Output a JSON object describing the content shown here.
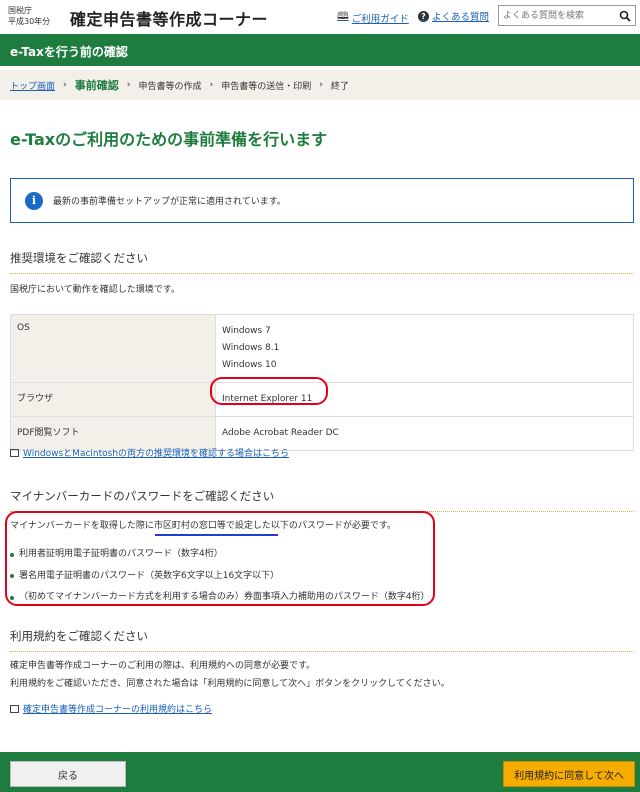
{
  "header": {
    "agency_line1": "国税庁",
    "agency_line2": "平成30年分",
    "site_title": "確定申告書等作成コーナー",
    "guide_link": "ご利用ガイド",
    "faq_link": "よくある質問",
    "search_placeholder": "よくある質問を検索"
  },
  "banner": {
    "title": "e-Taxを行う前の確認"
  },
  "breadcrumb": {
    "items": [
      "トップ画面",
      "事前確認",
      "申告書等の作成",
      "申告書等の送信・印刷",
      "終了"
    ]
  },
  "page_title": "e-Taxのご利用のための事前準備を行います",
  "info_message": "最新の事前準備セットアップが正常に適用されています。",
  "env_section": {
    "heading": "推奨環境をご確認ください",
    "desc": "国税庁において動作を確認した環境です。",
    "rows": [
      {
        "key": "OS",
        "values": [
          "Windows 7",
          "Windows 8.1",
          "Windows 10"
        ]
      },
      {
        "key": "ブラウザ",
        "values": [
          "Internet Explorer 11"
        ]
      },
      {
        "key": "PDF閲覧ソフト",
        "values": [
          "Adobe Acrobat Reader DC"
        ]
      }
    ],
    "link": "WindowsとMacintoshの両方の推奨環境を確認する場合はこちら"
  },
  "password_section": {
    "heading": "マイナンバーカードのパスワードをご確認ください",
    "intro_before": "マイナンバーカードを取得した際に",
    "intro_highlight": "市区町村の窓口等で設定した",
    "intro_after": "以下のパスワードが必要です。",
    "items": [
      "利用者証明用電子証明書のパスワード（数字4桁）",
      "署名用電子証明書のパスワード（英数字6文字以上16文字以下）",
      "（初めてマイナンバーカード方式を利用する場合のみ）券面事項入力補助用のパスワード（数字4桁）"
    ]
  },
  "terms_section": {
    "heading": "利用規約をご確認ください",
    "line1": "確定申告書等作成コーナーのご利用の際は、利用規約への同意が必要です。",
    "line2": "利用規約をご確認いただき、同意された場合は「利用規約に同意して次へ」ボタンをクリックしてください。",
    "link": "確定申告書等作成コーナーの利用規約はこちら"
  },
  "footer": {
    "back_label": "戻る",
    "next_label": "利用規約に同意して次へ"
  },
  "colors": {
    "brand_green": "#1e7c3f",
    "accent_orange": "#f6ad00",
    "annotation_red": "#e3001a",
    "annotation_blue": "#1f3fd0"
  }
}
